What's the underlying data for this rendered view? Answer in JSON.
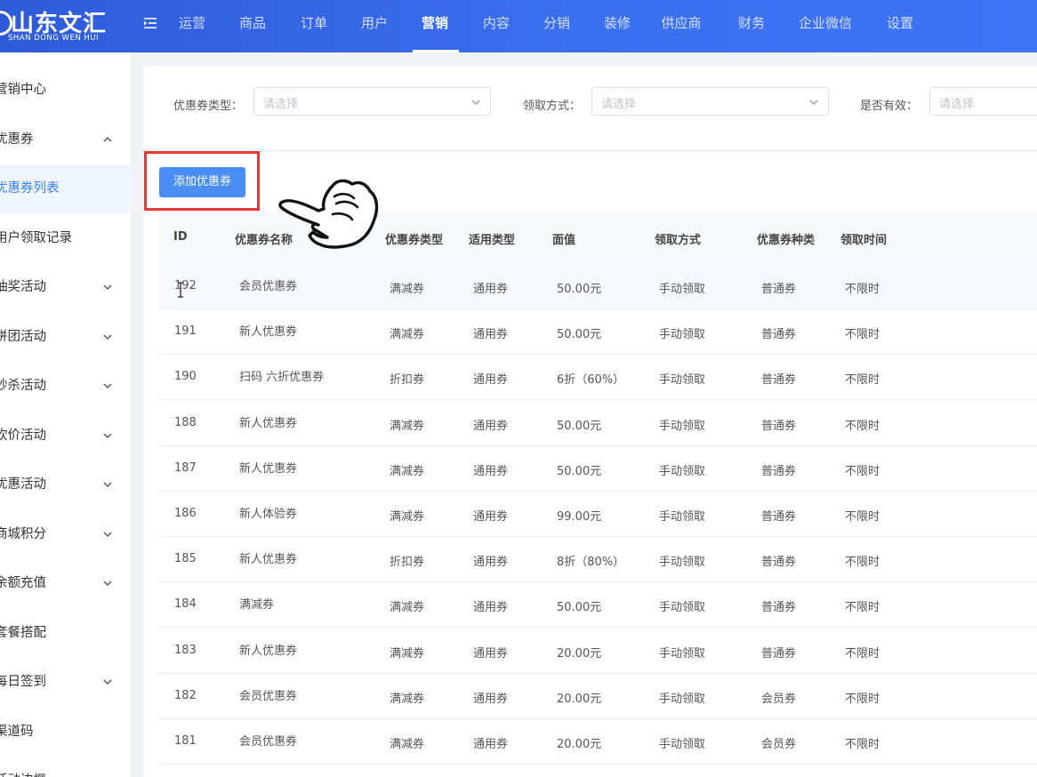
{
  "brand": {
    "name_cn": "山东文汇",
    "name_en": "SHAN DONG WEN HUI"
  },
  "topnav": {
    "items": [
      "运营",
      "商品",
      "订单",
      "用户",
      "营销",
      "内容",
      "分销",
      "装修",
      "供应商",
      "财务",
      "企业微信",
      "设置"
    ],
    "active": "营销"
  },
  "sidebar": {
    "items": [
      {
        "label": "营销中心",
        "chevron": ""
      },
      {
        "label": "优惠券",
        "chevron": "up"
      },
      {
        "label": "优惠券列表",
        "chevron": "",
        "active": true
      },
      {
        "label": "用户领取记录",
        "chevron": ""
      },
      {
        "label": "抽奖活动",
        "chevron": "down"
      },
      {
        "label": "拼团活动",
        "chevron": "down"
      },
      {
        "label": "秒杀活动",
        "chevron": "down"
      },
      {
        "label": "砍价活动",
        "chevron": "down"
      },
      {
        "label": "优惠活动",
        "chevron": "down"
      },
      {
        "label": "商城积分",
        "chevron": "down"
      },
      {
        "label": "余额充值",
        "chevron": "down"
      },
      {
        "label": "套餐搭配",
        "chevron": ""
      },
      {
        "label": "每日签到",
        "chevron": "down"
      },
      {
        "label": "渠道码",
        "chevron": ""
      },
      {
        "label": "活动边框",
        "chevron": ""
      }
    ]
  },
  "filters": {
    "type_label": "优惠券类型：",
    "type_placeholder": "请选择",
    "method_label": "领取方式：",
    "method_placeholder": "请选择",
    "valid_label": "是否有效：",
    "valid_placeholder": "请选择"
  },
  "toolbar": {
    "add_label": "添加优惠券"
  },
  "table": {
    "columns": [
      "ID",
      "优惠券名称",
      "优惠券类型",
      "适用类型",
      "面值",
      "领取方式",
      "优惠券种类",
      "领取时间"
    ],
    "rows": [
      [
        "192",
        "会员优惠券",
        "满减券",
        "通用券",
        "50.00元",
        "手动领取",
        "普通券",
        "不限时"
      ],
      [
        "191",
        "新人优惠券",
        "满减券",
        "通用券",
        "50.00元",
        "手动领取",
        "普通券",
        "不限时"
      ],
      [
        "190",
        "扫码 六折优惠券",
        "折扣券",
        "通用券",
        "6折（60%）",
        "手动领取",
        "普通券",
        "不限时"
      ],
      [
        "188",
        "新人优惠券",
        "满减券",
        "通用券",
        "50.00元",
        "手动领取",
        "普通券",
        "不限时"
      ],
      [
        "187",
        "新人优惠券",
        "满减券",
        "通用券",
        "50.00元",
        "手动领取",
        "普通券",
        "不限时"
      ],
      [
        "186",
        "新人体验券",
        "满减券",
        "通用券",
        "99.00元",
        "手动领取",
        "普通券",
        "不限时"
      ],
      [
        "185",
        "新人优惠券",
        "折扣券",
        "通用券",
        "8折（80%）",
        "手动领取",
        "普通券",
        "不限时"
      ],
      [
        "184",
        "满减券",
        "满减券",
        "通用券",
        "50.00元",
        "手动领取",
        "普通券",
        "不限时"
      ],
      [
        "183",
        "新人优惠券",
        "满减券",
        "通用券",
        "20.00元",
        "手动领取",
        "普通券",
        "不限时"
      ],
      [
        "182",
        "会员优惠券",
        "满减券",
        "通用券",
        "20.00元",
        "手动领取",
        "会员券",
        "不限时"
      ],
      [
        "181",
        "会员优惠券",
        "满减券",
        "通用券",
        "20.00元",
        "手动领取",
        "会员券",
        "不限时"
      ]
    ]
  },
  "colors": {
    "primary": "#3a6ff0",
    "button": "#4a8ef5",
    "highlight": "#e53935"
  },
  "icons": {
    "menu_toggle": "menu-fold-icon",
    "select_arrow": "chevron-down-icon",
    "pointer": "hand-pointer-icon",
    "cursor": "text-cursor-icon"
  }
}
